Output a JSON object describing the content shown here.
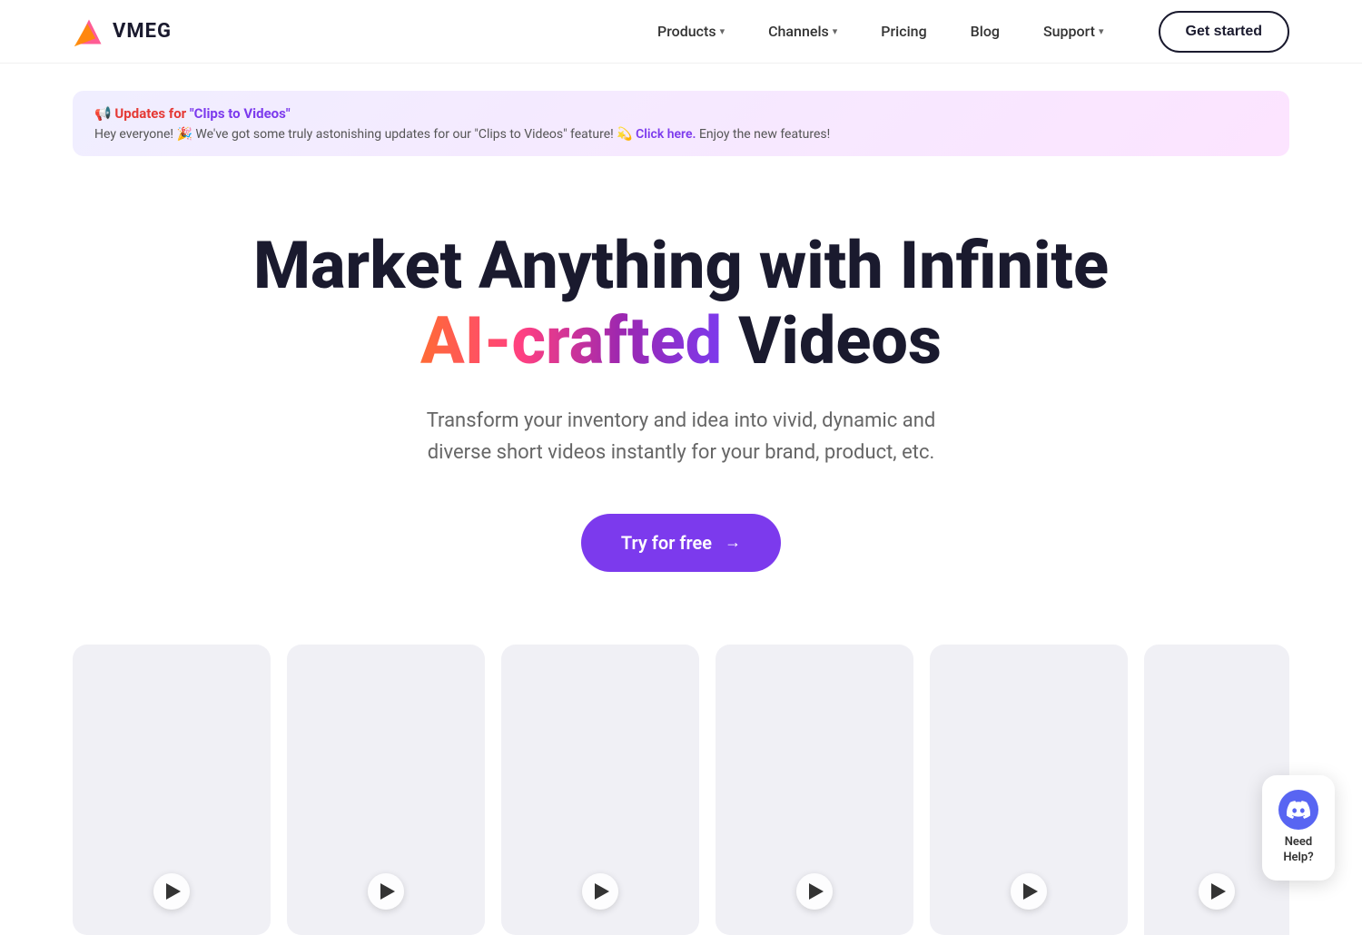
{
  "nav": {
    "logo_text": "VMEG",
    "links": [
      {
        "label": "Products",
        "has_dropdown": true
      },
      {
        "label": "Channels",
        "has_dropdown": true
      },
      {
        "label": "Pricing",
        "has_dropdown": false
      },
      {
        "label": "Blog",
        "has_dropdown": false
      },
      {
        "label": "Support",
        "has_dropdown": true
      }
    ],
    "cta_label": "Get started"
  },
  "announcement": {
    "icon": "📢",
    "title_prefix": " Updates for ",
    "title_highlight": "\"Clips to Videos\"",
    "body_prefix": "Hey everyone! 🎉 We've got some truly astonishing updates for our \"Clips to Videos\" feature! 💫 ",
    "body_link": "Click here.",
    "body_suffix": " Enjoy the new features!"
  },
  "hero": {
    "heading_line1": "Market Anything with Infinite",
    "heading_line2_gradient": "AI-crafted",
    "heading_line2_normal": " Videos",
    "subtext": "Transform your inventory and idea into vivid, dynamic and diverse short videos instantly for your brand, product, etc.",
    "cta_label": "Try for free",
    "cta_arrow": "→"
  },
  "videos": [
    {
      "id": 1
    },
    {
      "id": 2
    },
    {
      "id": 3
    },
    {
      "id": 4
    },
    {
      "id": 5
    },
    {
      "id": 6
    }
  ],
  "discord": {
    "label": "Need\nHelp?"
  },
  "colors": {
    "accent_purple": "#7c3aed",
    "gradient_start": "#ff6b35",
    "gradient_mid1": "#ff4081",
    "gradient_mid2": "#9c27b0",
    "gradient_end": "#7c3aed"
  }
}
